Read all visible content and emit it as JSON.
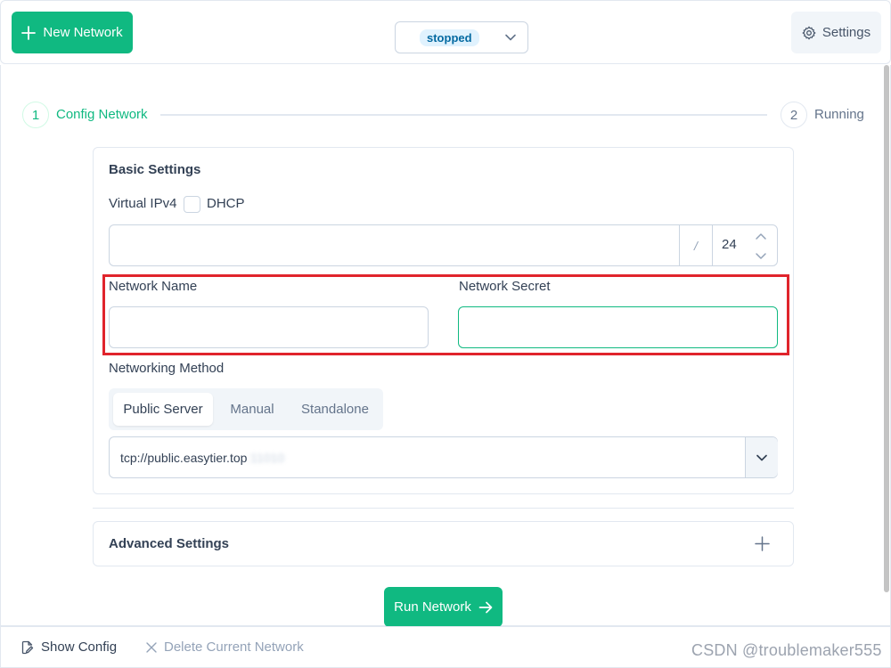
{
  "toolbar": {
    "new_network_label": "New Network",
    "status_value": "stopped",
    "settings_label": "Settings"
  },
  "stepper": {
    "steps": [
      {
        "number": "1",
        "label": "Config Network",
        "state": "active"
      },
      {
        "number": "2",
        "label": "Running",
        "state": "pending"
      }
    ]
  },
  "basic": {
    "title": "Basic Settings",
    "virtual_ipv4_label": "Virtual IPv4",
    "dhcp_label": "DHCP",
    "dhcp_checked": false,
    "ipv4_value": "",
    "slash": "/",
    "mask_value": "24",
    "network_name_label": "Network Name",
    "network_name_value": "",
    "network_secret_label": "Network Secret",
    "network_secret_value": "",
    "networking_method_label": "Networking Method",
    "methods": [
      "Public Server",
      "Manual",
      "Standalone"
    ],
    "selected_method": "Public Server",
    "server_value": "tcp://public.easytier.top",
    "server_port_blurred": ":11010"
  },
  "advanced": {
    "title": "Advanced Settings"
  },
  "run_button_label": "Run Network",
  "footer": {
    "show_config_label": "Show Config",
    "delete_label": "Delete Current Network"
  },
  "watermark": "CSDN @troublemaker555",
  "colors": {
    "primary": "#10b981",
    "highlight": "#e0242c",
    "badge_bg": "#e0f2fe",
    "badge_text": "#0369a1"
  }
}
